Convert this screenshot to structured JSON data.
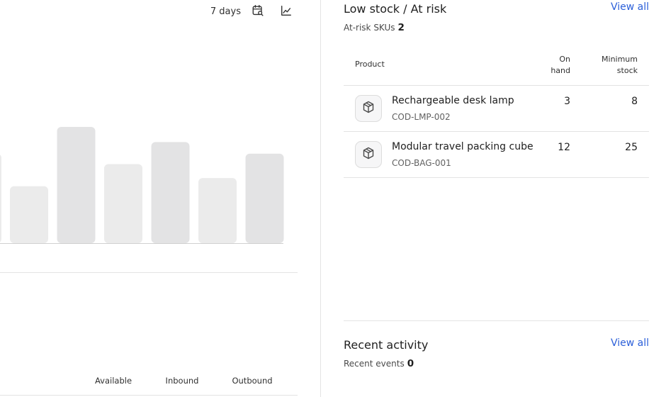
{
  "toolbar": {
    "range_label": "7 days",
    "calendar_icon": "calendar-search-icon",
    "chart_icon": "line-chart-icon"
  },
  "chart_data": {
    "type": "bar",
    "bars_visible": 6,
    "values": [
      49,
      100,
      68,
      87,
      56,
      77
    ],
    "partial_bar_value": 77,
    "colors": {
      "bar_a": "#ebebeb",
      "bar_b": "#e3e3e4"
    },
    "grid": false
  },
  "legend": {
    "items": [
      "Available",
      "Inbound",
      "Outbound"
    ]
  },
  "low_stock": {
    "title": "Low stock / At risk",
    "view_all": "View all",
    "meta_label": "At-risk SKUs",
    "meta_value": "2",
    "columns": {
      "product": "Product",
      "on_hand_1": "On",
      "on_hand_2": "hand",
      "min_1": "Minimum",
      "min_2": "stock"
    },
    "rows": [
      {
        "name": "Rechargeable desk lamp",
        "sku": "COD-LMP-002",
        "on_hand": "3",
        "minimum": "8",
        "icon": "box-icon"
      },
      {
        "name": "Modular travel packing cube",
        "sku": "COD-BAG-001",
        "on_hand": "12",
        "minimum": "25",
        "icon": "box-icon"
      }
    ]
  },
  "recent_activity": {
    "title": "Recent activity",
    "view_all": "View all",
    "meta_label": "Recent events",
    "meta_value": "0"
  },
  "colors": {
    "link": "#2b5fd9",
    "divider": "#e3e3e3",
    "text": "#1f1f1f"
  }
}
